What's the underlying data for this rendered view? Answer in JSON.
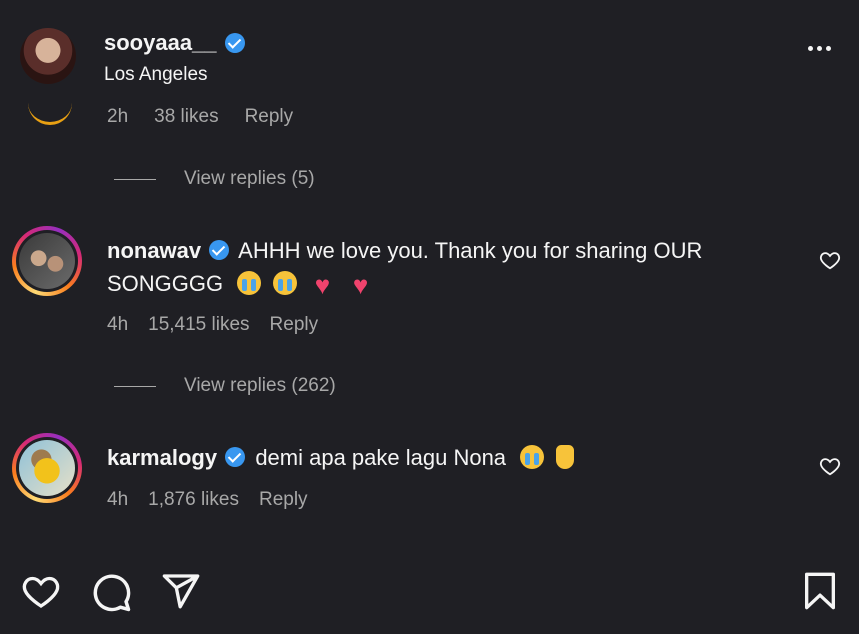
{
  "header": {
    "username": "sooyaaa__",
    "location": "Los Angeles"
  },
  "previous_comment": {
    "time": "2h",
    "likes": "38 likes",
    "reply": "Reply"
  },
  "view_replies_1": "View replies (5)",
  "comments": [
    {
      "username": "nonawav",
      "text_line1": "AHHH we love you. Thank you for sharing OUR",
      "text_line2": "SONGGGG",
      "time": "4h",
      "likes": "15,415 likes",
      "reply": "Reply"
    },
    {
      "username": "karmalogy",
      "text": "demi apa pake lagu Nona",
      "time": "4h",
      "likes": "1,876 likes",
      "reply": "Reply"
    }
  ],
  "view_replies_2": "View replies (262)",
  "icons": {
    "more": "more-horizontal-icon",
    "verified": "verified-badge-icon",
    "like": "heart-icon",
    "comment": "comment-bubble-icon",
    "share": "paper-plane-icon",
    "save": "bookmark-icon"
  },
  "colors": {
    "background": "#1f1f24",
    "text": "#f5f5f5",
    "muted": "#a8a8a8",
    "verified": "#3897f0"
  }
}
